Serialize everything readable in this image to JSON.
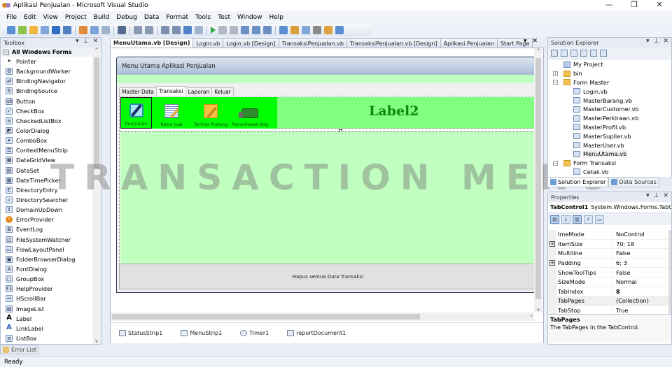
{
  "window": {
    "title": "Aplikasi Penjualan - Microsoft Visual Studio",
    "controls": {
      "minimize": "—",
      "restore": "❐",
      "close": "✕"
    }
  },
  "menubar": [
    "File",
    "Edit",
    "View",
    "Project",
    "Build",
    "Debug",
    "Data",
    "Format",
    "Tools",
    "Test",
    "Window",
    "Help"
  ],
  "toolbar": {
    "icons": [
      "new-project-icon",
      "add-item-icon",
      "open-file-icon",
      "add-new-item-icon",
      "save-icon",
      "save-all-icon",
      "cut-icon",
      "copy-icon",
      "paste-icon",
      "find-icon",
      "comment-icon",
      "uncomment-icon",
      "undo-icon",
      "redo-icon",
      "navigate-icon",
      "find-in-files-icon",
      "start-debug-icon",
      "pause-icon",
      "stop-icon",
      "step-into-icon",
      "step-over-icon",
      "step-out-icon",
      "solution-explorer-icon",
      "properties-icon",
      "object-browser-icon",
      "toolbox-icon",
      "error-list-icon",
      "output-icon"
    ]
  },
  "toolbox": {
    "title": "Toolbox",
    "group": "All Windows Forms",
    "items": [
      {
        "label": "Pointer",
        "glyph": "➤"
      },
      {
        "label": "BackgroundWorker",
        "glyph": "⚙"
      },
      {
        "label": "BindingNavigator",
        "glyph": "⇄"
      },
      {
        "label": "BindingSource",
        "glyph": "⇅"
      },
      {
        "label": "Button",
        "glyph": "ab"
      },
      {
        "label": "CheckBox",
        "glyph": "✓"
      },
      {
        "label": "CheckedListBox",
        "glyph": "≡"
      },
      {
        "label": "ColorDialog",
        "glyph": "◩"
      },
      {
        "label": "ComboBox",
        "glyph": "▾"
      },
      {
        "label": "ContextMenuStrip",
        "glyph": "☰"
      },
      {
        "label": "DataGridView",
        "glyph": "▦"
      },
      {
        "label": "DataSet",
        "glyph": "▤"
      },
      {
        "label": "DateTimePicker",
        "glyph": "▦"
      },
      {
        "label": "DirectoryEntry",
        "glyph": "E"
      },
      {
        "label": "DirectorySearcher",
        "glyph": "⌕"
      },
      {
        "label": "DomainUpDown",
        "glyph": "↕"
      },
      {
        "label": "ErrorProvider",
        "glyph": "!"
      },
      {
        "label": "EventLog",
        "glyph": "≣"
      },
      {
        "label": "FileSystemWatcher",
        "glyph": "◫"
      },
      {
        "label": "FlowLayoutPanel",
        "glyph": "▭"
      },
      {
        "label": "FolderBrowserDialog",
        "glyph": "▣"
      },
      {
        "label": "FontDialog",
        "glyph": "A"
      },
      {
        "label": "GroupBox",
        "glyph": "▢"
      },
      {
        "label": "HelpProvider",
        "glyph": "F1"
      },
      {
        "label": "HScrollBar",
        "glyph": "↔"
      },
      {
        "label": "ImageList",
        "glyph": "▧"
      },
      {
        "label": "Label",
        "glyph": "A"
      },
      {
        "label": "LinkLabel",
        "glyph": "A"
      },
      {
        "label": "ListBox",
        "glyph": "≡"
      }
    ],
    "scroll_up": "^",
    "scroll_down": "v"
  },
  "bottom": {
    "error_list_tab": "Error List",
    "status": "Ready"
  },
  "document_tabs": [
    {
      "label": "MenuUtama.vb [Design]",
      "active": true
    },
    {
      "label": "Login.vb",
      "active": false
    },
    {
      "label": "Login.vb [Design]",
      "active": false
    },
    {
      "label": "TransaksiPenjualan.vb",
      "active": false
    },
    {
      "label": "TransaksiPenjualan.vb [Design]",
      "active": false
    },
    {
      "label": "Aplikasi Penjualan",
      "active": false
    },
    {
      "label": "Start Page",
      "active": false
    }
  ],
  "designer": {
    "form_caption": "Menu Utama Aplikasi Penjualan",
    "tabs": [
      {
        "label": "Master Data",
        "active": false
      },
      {
        "label": "Transaksi",
        "active": true
      },
      {
        "label": "Laporan",
        "active": false
      },
      {
        "label": "Keluar",
        "active": false
      }
    ],
    "tool_buttons": [
      {
        "label": "Penjualan",
        "icon": "edit-document-icon",
        "selected": true
      },
      {
        "label": "Retur Jual",
        "icon": "return-invoice-icon",
        "selected": false
      },
      {
        "label": "Terima Piutang",
        "icon": "receivable-note-icon",
        "selected": false
      },
      {
        "label": "Penerimaan Brg",
        "icon": "delivery-truck-icon",
        "selected": false
      }
    ],
    "label2": "Label2",
    "hapus_button": "Hapus semua Data Transaksi",
    "components": [
      {
        "label": "StatusStrip1",
        "icon": "status-strip-icon"
      },
      {
        "label": "MenuStrip1",
        "icon": "menu-strip-icon"
      },
      {
        "label": "Timer1",
        "icon": "timer-icon"
      },
      {
        "label": "reportDocument1",
        "icon": "report-document-icon"
      }
    ],
    "colors": {
      "tool_strip": "#00ff00",
      "label_panel": "#80ff80",
      "page_panel": "#c0ffc0",
      "label_text": "#0a8a0a"
    }
  },
  "watermark": "TRANSACTION MENU",
  "solution_explorer": {
    "title": "Solution Explorer",
    "tree": [
      {
        "label": "My Project",
        "type": "proj",
        "level": 1,
        "expander": ""
      },
      {
        "label": "bin",
        "type": "folder",
        "level": 1,
        "expander": "+"
      },
      {
        "label": "Form Master",
        "type": "folder",
        "level": 1,
        "expander": "−"
      },
      {
        "label": "Login.vb",
        "type": "file",
        "level": 2,
        "expander": ""
      },
      {
        "label": "MasterBarang.vb",
        "type": "file",
        "level": 2,
        "expander": ""
      },
      {
        "label": "MasterCustomer.vb",
        "type": "file",
        "level": 2,
        "expander": ""
      },
      {
        "label": "MasterPerkiraan.vb",
        "type": "file",
        "level": 2,
        "expander": ""
      },
      {
        "label": "MasterProfil.vb",
        "type": "file",
        "level": 2,
        "expander": ""
      },
      {
        "label": "MasterSuplier.vb",
        "type": "file",
        "level": 2,
        "expander": ""
      },
      {
        "label": "MasterUser.vb",
        "type": "file",
        "level": 2,
        "expander": ""
      },
      {
        "label": "MenuUtama.vb",
        "type": "file",
        "level": 2,
        "expander": "",
        "selected": true
      },
      {
        "label": "Form Transaksi",
        "type": "folder",
        "level": 1,
        "expander": "−"
      },
      {
        "label": "Cetak.vb",
        "type": "file",
        "level": 2,
        "expander": ""
      }
    ],
    "bottom_tabs": [
      {
        "label": "Solution Explorer",
        "active": true
      },
      {
        "label": "Data Sources",
        "active": false
      }
    ]
  },
  "properties": {
    "title": "Properties",
    "object_name": "TabControl1",
    "object_type": "System.Windows.Forms.TabControl",
    "rows": [
      {
        "name": "ImeMode",
        "value": "NoControl",
        "expandable": false,
        "bold": false
      },
      {
        "name": "ItemSize",
        "value": "70; 18",
        "expandable": true,
        "bold": false
      },
      {
        "name": "Multiline",
        "value": "False",
        "expandable": false,
        "bold": false
      },
      {
        "name": "Padding",
        "value": "6; 3",
        "expandable": true,
        "bold": false
      },
      {
        "name": "ShowToolTips",
        "value": "False",
        "expandable": false,
        "bold": false
      },
      {
        "name": "SizeMode",
        "value": "Normal",
        "expandable": false,
        "bold": false
      },
      {
        "name": "TabIndex",
        "value": "8",
        "expandable": false,
        "bold": true
      },
      {
        "name": "TabPages",
        "value": "(Collection)",
        "expandable": false,
        "bold": false,
        "selected": true
      },
      {
        "name": "TabStop",
        "value": "True",
        "expandable": false,
        "bold": false
      }
    ],
    "description_title": "TabPages",
    "description_text": "The TabPages in the TabControl."
  },
  "pane_controls": {
    "dropdown": "▾",
    "pin": "⊥",
    "close": "✕"
  }
}
